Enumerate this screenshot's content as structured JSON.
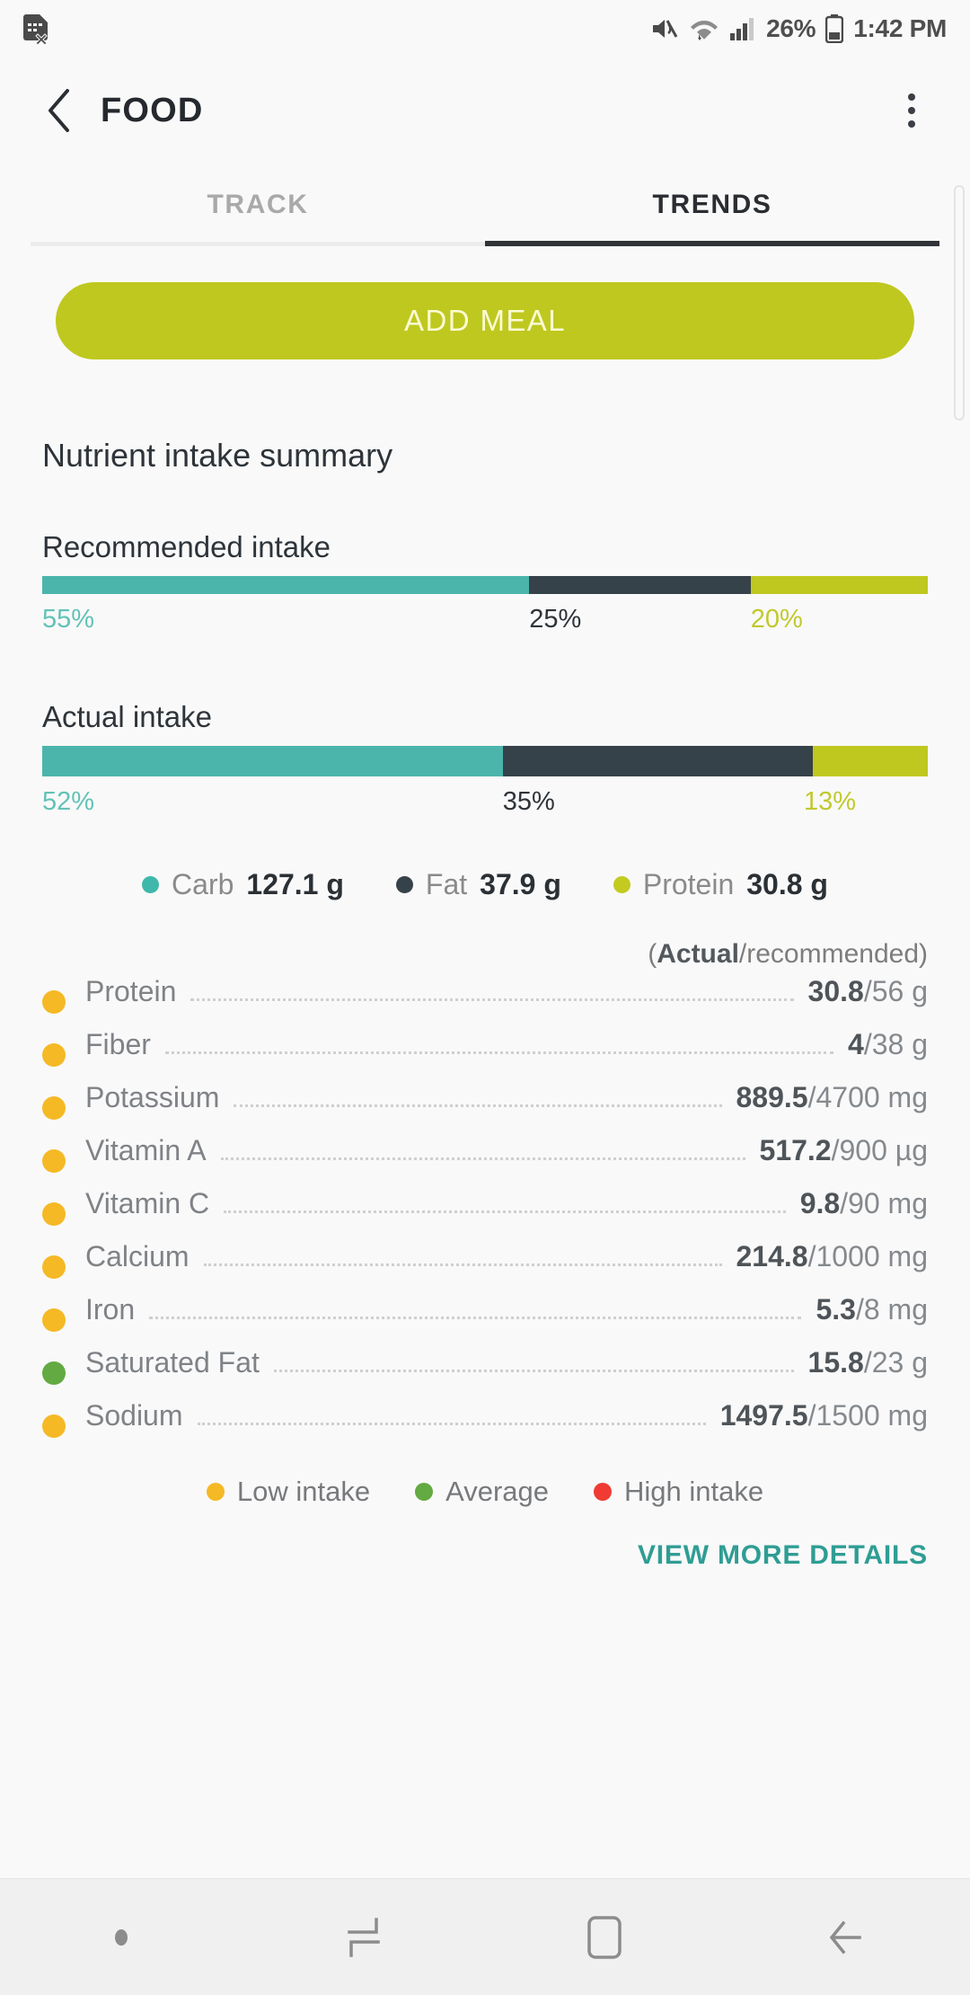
{
  "status_bar": {
    "battery_percent": "26%",
    "time": "1:42 PM",
    "icons": [
      "sim-card-error-icon",
      "mute-icon",
      "wifi-icon",
      "signal-icon",
      "battery-icon"
    ]
  },
  "app_bar": {
    "title": "FOOD",
    "back_icon": "chevron-left-icon",
    "overflow_icon": "more-vertical-icon"
  },
  "tabs": [
    {
      "label": "TRACK",
      "active": false
    },
    {
      "label": "TRENDS",
      "active": true
    }
  ],
  "add_meal_button": "ADD MEAL",
  "summary": {
    "heading": "Nutrient intake summary",
    "recommended": {
      "label": "Recommended intake",
      "carb_pct": "55%",
      "fat_pct": "25%",
      "protein_pct": "20%"
    },
    "actual": {
      "label": "Actual intake",
      "carb_pct": "52%",
      "fat_pct": "35%",
      "protein_pct": "13%"
    }
  },
  "macro_legend": [
    {
      "name": "Carb",
      "value": "127.1 g",
      "color": "#3fb8ab"
    },
    {
      "name": "Fat",
      "value": "37.9 g",
      "color": "#364249"
    },
    {
      "name": "Protein",
      "value": "30.8 g",
      "color": "#c3cb21"
    }
  ],
  "table": {
    "header": {
      "bold": "Actual",
      "rest": "/recommended)",
      "prefix": "("
    },
    "rows": [
      {
        "name": "Protein",
        "actual": "30.8",
        "rest": "/56 g",
        "status": "low"
      },
      {
        "name": "Fiber",
        "actual": "4",
        "rest": "/38 g",
        "status": "low"
      },
      {
        "name": "Potassium",
        "actual": "889.5",
        "rest": "/4700 mg",
        "status": "low"
      },
      {
        "name": "Vitamin A",
        "actual": "517.2",
        "rest": "/900 µg",
        "status": "low"
      },
      {
        "name": "Vitamin C",
        "actual": "9.8",
        "rest": "/90 mg",
        "status": "low"
      },
      {
        "name": "Calcium",
        "actual": "214.8",
        "rest": "/1000 mg",
        "status": "low"
      },
      {
        "name": "Iron",
        "actual": "5.3",
        "rest": "/8 mg",
        "status": "low"
      },
      {
        "name": "Saturated Fat",
        "actual": "15.8",
        "rest": "/23 g",
        "status": "avg"
      },
      {
        "name": "Sodium",
        "actual": "1497.5",
        "rest": "/1500 mg",
        "status": "low"
      }
    ]
  },
  "status_legend": [
    {
      "label": "Low intake",
      "color": "#f5b926"
    },
    {
      "label": "Average",
      "color": "#62aa41"
    },
    {
      "label": "High intake",
      "color": "#ef3b33"
    }
  ],
  "view_more": "VIEW MORE DETAILS",
  "nav_bar": {
    "items": [
      "indicator-dot",
      "recents-icon",
      "home-icon",
      "back-icon"
    ]
  },
  "colors": {
    "carb": "#4cb5ab",
    "fat": "#364249",
    "protein": "#bfc81f",
    "accent_teal": "#2f9d94",
    "button": "#bfc81f"
  }
}
